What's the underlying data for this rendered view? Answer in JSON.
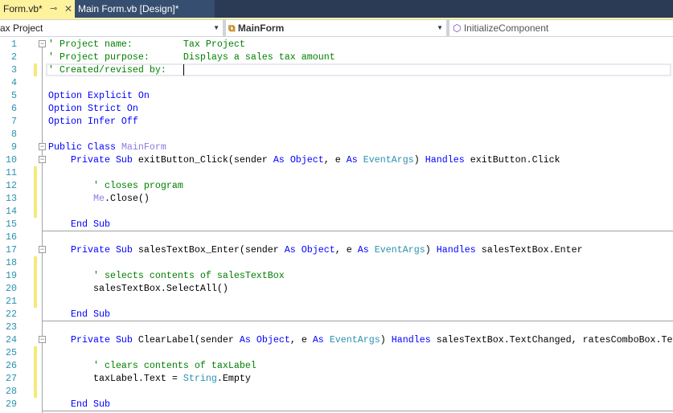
{
  "tabs": [
    {
      "label": "Form.vb*",
      "active": true
    },
    {
      "label": "Main Form.vb [Design]*",
      "active": false
    }
  ],
  "nav": {
    "project": "ax Project",
    "class": "MainForm",
    "member": "InitializeComponent"
  },
  "colors": {
    "keyword": "#0000ff",
    "comment": "#008000",
    "type": "#2b91af",
    "accent": "#fff29d"
  },
  "code": [
    [
      [
        "' Project name:         Tax Project",
        "c"
      ]
    ],
    [
      [
        "' Project purpose:      Displays a sales tax amount",
        "c"
      ]
    ],
    [
      [
        "' Created/revised by:",
        "c"
      ]
    ],
    [],
    [
      [
        "Option Explicit On",
        "k"
      ]
    ],
    [
      [
        "Option Strict On",
        "k"
      ]
    ],
    [
      [
        "Option Infer Off",
        "k"
      ]
    ],
    [],
    [
      [
        "Public Class ",
        "k"
      ],
      [
        "MainForm",
        "m"
      ]
    ],
    [
      [
        "    Private Sub ",
        "k"
      ],
      [
        "exitButton_Click(sender ",
        ""
      ],
      [
        "As Object",
        ""
      ],
      [
        ", e ",
        ""
      ],
      [
        "As ",
        "k"
      ],
      [
        "EventArgs",
        "t"
      ],
      [
        ") ",
        ""
      ],
      [
        "Handles ",
        "k"
      ],
      [
        "exitButton.Click",
        ""
      ]
    ],
    [],
    [
      [
        "        ' closes program",
        "c"
      ]
    ],
    [
      [
        "        ",
        ""
      ],
      [
        "Me",
        "m"
      ],
      [
        ".Close()",
        ""
      ]
    ],
    [],
    [
      [
        "    End Sub",
        "k"
      ]
    ],
    [],
    [
      [
        "    Private Sub ",
        "k"
      ],
      [
        "salesTextBox_Enter(sender ",
        ""
      ],
      [
        "As Object",
        "k"
      ],
      [
        ", e ",
        ""
      ],
      [
        "As ",
        "k"
      ],
      [
        "EventArgs",
        "t"
      ],
      [
        ") ",
        ""
      ],
      [
        "Handles ",
        "k"
      ],
      [
        "salesTextBox.Enter",
        ""
      ]
    ],
    [],
    [
      [
        "        ' selects contents of salesTextBox",
        "c"
      ]
    ],
    [
      [
        "        salesTextBox.SelectAll()",
        ""
      ]
    ],
    [],
    [
      [
        "    End Sub",
        "k"
      ]
    ],
    [],
    [
      [
        "    Private Sub ",
        "k"
      ],
      [
        "ClearLabel(sender ",
        ""
      ],
      [
        "As Object",
        "k"
      ],
      [
        ", e ",
        ""
      ],
      [
        "As ",
        "k"
      ],
      [
        "EventArgs",
        "t"
      ],
      [
        ") ",
        ""
      ],
      [
        "Handles ",
        "k"
      ],
      [
        "salesTextBox.TextChanged, ratesComboBox.Te",
        ""
      ]
    ],
    [],
    [
      [
        "        ' clears contents of taxLabel",
        "c"
      ]
    ],
    [
      [
        "        taxLabel.Text = ",
        ""
      ],
      [
        "String",
        "t"
      ],
      [
        ".Empty",
        ""
      ]
    ],
    [],
    [
      [
        "    End Sub",
        "k"
      ]
    ]
  ]
}
